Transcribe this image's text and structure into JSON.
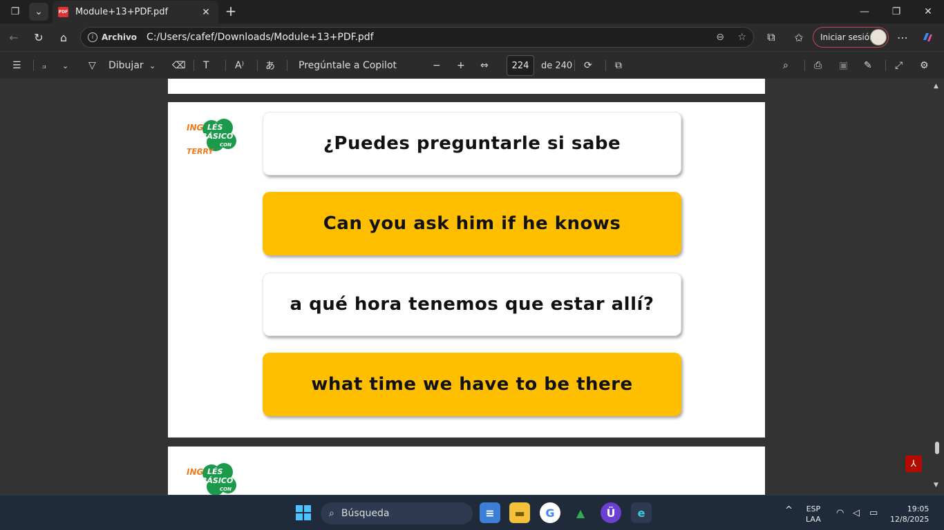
{
  "browser": {
    "tab_title": "Module+13+PDF.pdf",
    "address_label": "Archivo",
    "url": "C:/Users/cafef/Downloads/Module+13+PDF.pdf",
    "signin_label": "Iniciar sesión"
  },
  "pdf_toolbar": {
    "draw_label": "Dibujar",
    "copilot_label": "Pregúntale a Copilot",
    "page_current": "224",
    "page_total": "de 240"
  },
  "document": {
    "logo": {
      "ing": "ING",
      "les": "LÉS",
      "basico": "BÁSICO",
      "con": "CON",
      "terry": "TERRY"
    },
    "cards": [
      {
        "text": "¿Puedes preguntarle si sabe",
        "style": "white"
      },
      {
        "text": "Can you ask him if he knows",
        "style": "yellow"
      },
      {
        "text": "a qué hora tenemos que estar allí?",
        "style": "white"
      },
      {
        "text": "what time we have to be there",
        "style": "yellow"
      }
    ]
  },
  "taskbar": {
    "search_placeholder": "Búsqueda",
    "lang": "ESP",
    "lang_sub": "LAA",
    "time": "19:05",
    "date": "12/8/2025"
  },
  "colors": {
    "card_yellow": "#fdbf00",
    "logo_green": "#1a9a4a",
    "logo_orange": "#f07a1a"
  }
}
